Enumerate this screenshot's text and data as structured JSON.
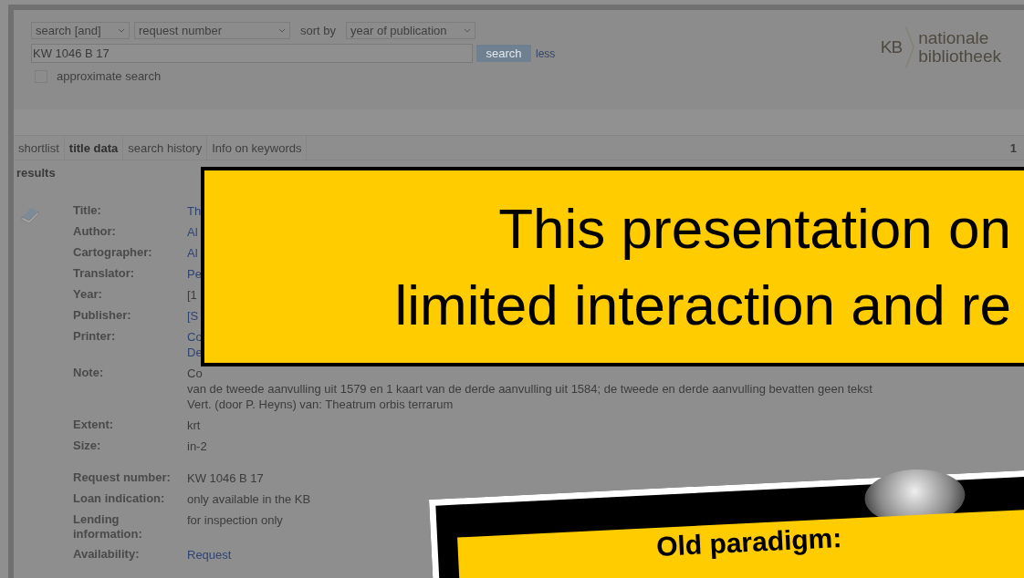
{
  "search_form": {
    "operator": "search [and]",
    "field": "request number",
    "sort_label": "sort by",
    "sort": "year of publication",
    "query": "KW 1046 B 17",
    "search_button": "search",
    "less_link": "less",
    "approximate": {
      "label": "approximate search",
      "checked": false
    }
  },
  "logo": {
    "mark": "KB",
    "line1": "nationale",
    "line2": "bibliotheek"
  },
  "tabs": [
    {
      "label": "shortlist",
      "selected": false
    },
    {
      "label": "title data",
      "selected": true
    },
    {
      "label": "search history",
      "selected": false
    },
    {
      "label": "Info on keywords",
      "selected": false
    }
  ],
  "page_number": "1",
  "results_heading": "results",
  "field_groups": [
    [
      {
        "label": "Title:",
        "lines": [
          "Th"
        ],
        "link": true
      },
      {
        "label": "Author:",
        "lines": [
          "Al"
        ],
        "link": true
      },
      {
        "label": "Cartographer:",
        "lines": [
          "Al"
        ],
        "link": true
      },
      {
        "label": "Translator:",
        "lines": [
          "Pe"
        ],
        "link": true
      },
      {
        "label": "Year:",
        "lines": [
          "[1"
        ],
        "link": false
      },
      {
        "label": "Publisher:",
        "lines": [
          "[S"
        ],
        "link": true
      },
      {
        "label": "Printer:",
        "lines": [
          "Co",
          "De"
        ],
        "link": true
      },
      {
        "label": "Note:",
        "lines": [
          "Co",
          "van de tweede aanvulling uit 1579 en 1 kaart van de derde aanvulling uit 1584; de tweede en derde aanvulling bevatten geen tekst",
          "Vert. (door P. Heyns) van: Theatrum orbis terrarum"
        ],
        "link": false
      },
      {
        "label": "Extent:",
        "lines": [
          "krt"
        ],
        "link": false
      },
      {
        "label": "Size:",
        "lines": [
          "in-2"
        ],
        "link": false
      }
    ],
    [
      {
        "label": "Request number:",
        "lines": [
          "KW 1046 B 17"
        ],
        "link": false
      },
      {
        "label": "Loan indication:",
        "lines": [
          "only available in the KB"
        ],
        "link": false
      },
      {
        "label": "Lending information:",
        "lines": [
          "for inspection only"
        ],
        "link": false
      },
      {
        "label": "Availability:",
        "lines": [
          "Request"
        ],
        "link": true
      }
    ]
  ],
  "banner": {
    "lines": [
      "This presentation on",
      "limited interaction and re"
    ]
  },
  "card": {
    "title": "Old paradigm:"
  }
}
